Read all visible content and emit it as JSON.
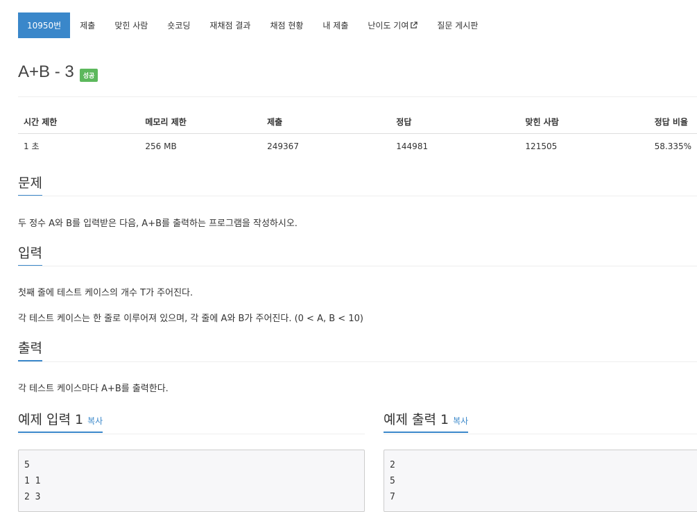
{
  "tabs": [
    {
      "label": "10950번",
      "active": true
    },
    {
      "label": "제출"
    },
    {
      "label": "맞힌 사람"
    },
    {
      "label": "숏코딩"
    },
    {
      "label": "재채점 결과"
    },
    {
      "label": "채점 현황"
    },
    {
      "label": "내 제출"
    },
    {
      "label": "난이도 기여"
    },
    {
      "label": "질문 게시판"
    }
  ],
  "problem": {
    "title": "A+B - 3",
    "badge": "성공"
  },
  "info_table": {
    "headers": [
      "시간 제한",
      "메모리 제한",
      "제출",
      "정답",
      "맞힌 사람",
      "정답 비율"
    ],
    "row": [
      "1 초",
      "256 MB",
      "249367",
      "144981",
      "121505",
      "58.335%"
    ]
  },
  "sections": {
    "problem": {
      "heading": "문제",
      "lines": [
        "두 정수 A와 B를 입력받은 다음, A+B를 출력하는 프로그램을 작성하시오."
      ]
    },
    "input": {
      "heading": "입력",
      "lines": [
        "첫째 줄에 테스트 케이스의 개수 T가 주어진다.",
        "각 테스트 케이스는 한 줄로 이루어져 있으며, 각 줄에 A와 B가 주어진다. (0 < A, B < 10)"
      ]
    },
    "output": {
      "heading": "출력",
      "lines": [
        "각 테스트 케이스마다 A+B를 출력한다."
      ]
    }
  },
  "samples": {
    "input": {
      "heading": "예제 입력 1",
      "copy": "복사",
      "lines": [
        "5",
        "1 1",
        "2 3"
      ]
    },
    "output": {
      "heading": "예제 출력 1",
      "copy": "복사",
      "lines": [
        "2",
        "5",
        "7"
      ]
    }
  },
  "colors": {
    "accent": "#3a87ca",
    "success": "#5cb85c"
  },
  "icons": {
    "external_link": "external-link-icon"
  }
}
